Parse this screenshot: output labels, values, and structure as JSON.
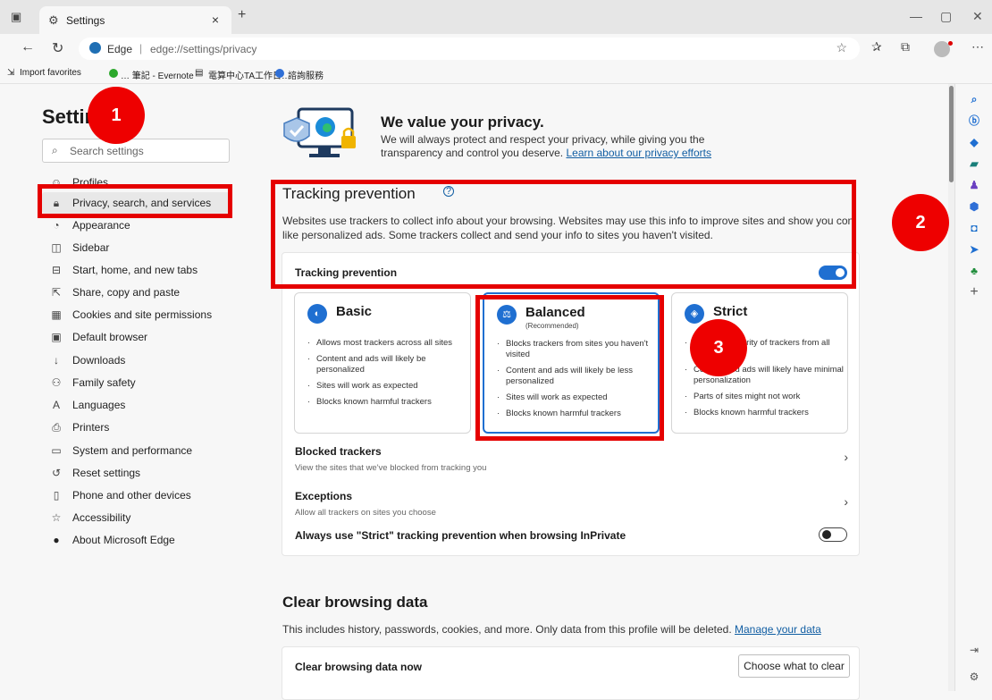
{
  "tab": {
    "title": "Settings",
    "close": "×",
    "new_tab": "+"
  },
  "window": {
    "minimize": "—",
    "maximize": "▢",
    "close": "✕"
  },
  "address": {
    "site": "Edge",
    "separator": "|",
    "url": "edge://settings/privacy"
  },
  "favorites": [
    {
      "label": "Import favorites"
    },
    {
      "label": "… 筆記 - Evernote"
    },
    {
      "label": "電算中心TA工作日…"
    },
    {
      "label": "諮詢服務"
    }
  ],
  "sidebar": {
    "title": "Settings",
    "search_placeholder": "Search settings",
    "items": [
      {
        "label": "Profiles",
        "icon": "person-icon"
      },
      {
        "label": "Privacy, search, and services",
        "icon": "lock-icon"
      },
      {
        "label": "Appearance",
        "icon": "palette-icon"
      },
      {
        "label": "Sidebar",
        "icon": "sidebar-icon"
      },
      {
        "label": "Start, home, and new tabs",
        "icon": "home-icon"
      },
      {
        "label": "Share, copy and paste",
        "icon": "share-icon"
      },
      {
        "label": "Cookies and site permissions",
        "icon": "cookie-icon"
      },
      {
        "label": "Default browser",
        "icon": "browser-icon"
      },
      {
        "label": "Downloads",
        "icon": "download-icon"
      },
      {
        "label": "Family safety",
        "icon": "family-icon"
      },
      {
        "label": "Languages",
        "icon": "language-icon"
      },
      {
        "label": "Printers",
        "icon": "printer-icon"
      },
      {
        "label": "System and performance",
        "icon": "laptop-icon"
      },
      {
        "label": "Reset settings",
        "icon": "reset-icon"
      },
      {
        "label": "Phone and other devices",
        "icon": "phone-icon"
      },
      {
        "label": "Accessibility",
        "icon": "accessibility-icon"
      },
      {
        "label": "About Microsoft Edge",
        "icon": "edge-icon"
      }
    ]
  },
  "hero": {
    "title": "We value your privacy.",
    "text": "We will always protect and respect your privacy, while giving you the transparency and control you deserve.",
    "link": "Learn about our privacy efforts"
  },
  "tracking": {
    "title": "Tracking prevention",
    "help": "?",
    "desc_line1": "Websites use trackers to collect info about your browsing. Websites may use this info to improve sites and show you content",
    "desc_line2": "like personalized ads. Some trackers collect and send your info to sites you haven't visited.",
    "toggle_label": "Tracking prevention",
    "enabled": true,
    "levels": [
      {
        "title": "Basic",
        "subtitle": "",
        "bullets": [
          "Allows most trackers across all sites",
          "Content and ads will likely be personalized",
          "Sites will work as expected",
          "Blocks known harmful trackers"
        ]
      },
      {
        "title": "Balanced",
        "subtitle": "(Recommended)",
        "bullets": [
          "Blocks trackers from sites you haven't visited",
          "Content and ads will likely be less personalized",
          "Sites will work as expected",
          "Blocks known harmful trackers"
        ]
      },
      {
        "title": "Strict",
        "subtitle": "",
        "bullets": [
          "Blocks a majority of trackers from all sites",
          "Content and ads will likely have minimal personalization",
          "Parts of sites might not work",
          "Blocks known harmful trackers"
        ]
      }
    ],
    "selected_level": "Balanced",
    "blocked": {
      "title": "Blocked trackers",
      "sub": "View the sites that we've blocked from tracking you"
    },
    "exceptions": {
      "title": "Exceptions",
      "sub": "Allow all trackers on sites you choose"
    },
    "strict_inprivate": {
      "label": "Always use \"Strict\" tracking prevention when browsing InPrivate",
      "enabled": false
    }
  },
  "clear": {
    "title": "Clear browsing data",
    "desc": "This includes history, passwords, cookies, and more. Only data from this profile will be deleted.",
    "link": "Manage your data",
    "row_label": "Clear browsing data now",
    "button": "Choose what to clear"
  },
  "annotations": {
    "badge1": "1",
    "badge2": "2",
    "badge3": "3"
  },
  "colors": {
    "accent": "#1f6fd1",
    "annotation_red": "#e50000",
    "link": "#115ea3"
  }
}
